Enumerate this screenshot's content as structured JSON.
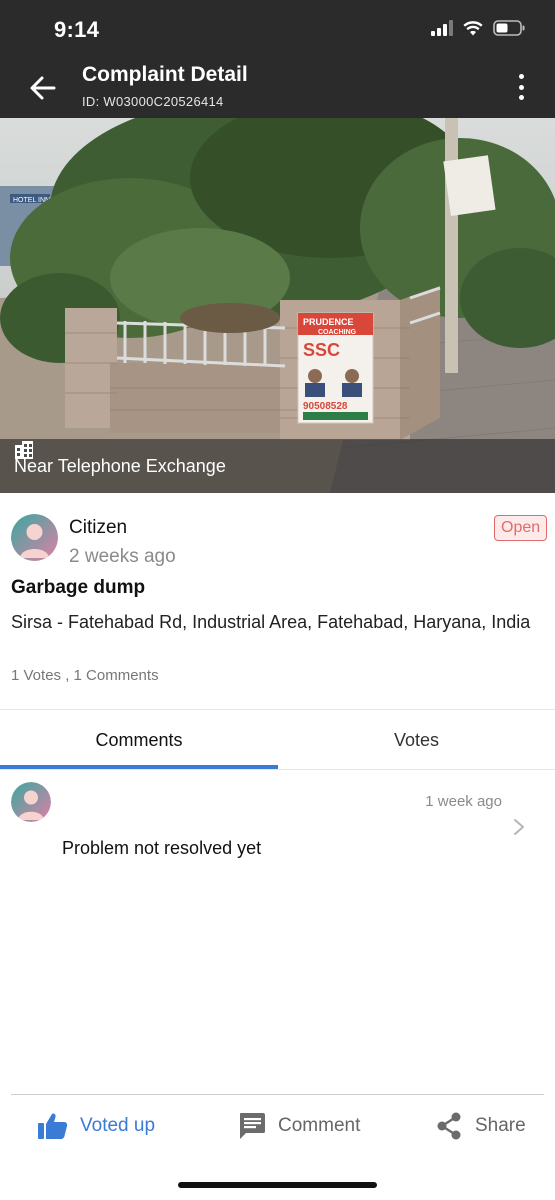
{
  "status_bar": {
    "time": "9:14"
  },
  "app_bar": {
    "title": "Complaint Detail",
    "subtitle": "ID: W03000C20526414"
  },
  "photo": {
    "location": "Near Telephone Exchange",
    "sign_lines": [
      "HOTEL INN"
    ],
    "poster_lines": [
      "PRUDENCE",
      "COACHING",
      "SSC",
      "90508528"
    ]
  },
  "complaint": {
    "author": "Citizen",
    "time_ago": "2 weeks ago",
    "status": "Open",
    "title": "Garbage dump",
    "address": "Sirsa - Fatehabad Rd, Industrial Area, Fatehabad, Haryana, India",
    "stats": "1 Votes , 1 Comments"
  },
  "tabs": [
    {
      "label": "Comments",
      "active": true
    },
    {
      "label": "Votes",
      "active": false
    }
  ],
  "comments": [
    {
      "time_ago": "1 week ago",
      "text": "Problem not resolved yet"
    }
  ],
  "actions": {
    "vote_label": "Voted up",
    "comment_label": "Comment",
    "share_label": "Share"
  },
  "colors": {
    "app_bar": "#2b2b2b",
    "accent": "#3a7bd5",
    "status_open": "#e26b6b"
  },
  "icons": [
    "back-arrow-icon",
    "more-vert-icon",
    "building-icon",
    "chevron-right-icon",
    "thumbs-up-icon",
    "comment-icon",
    "share-icon"
  ]
}
